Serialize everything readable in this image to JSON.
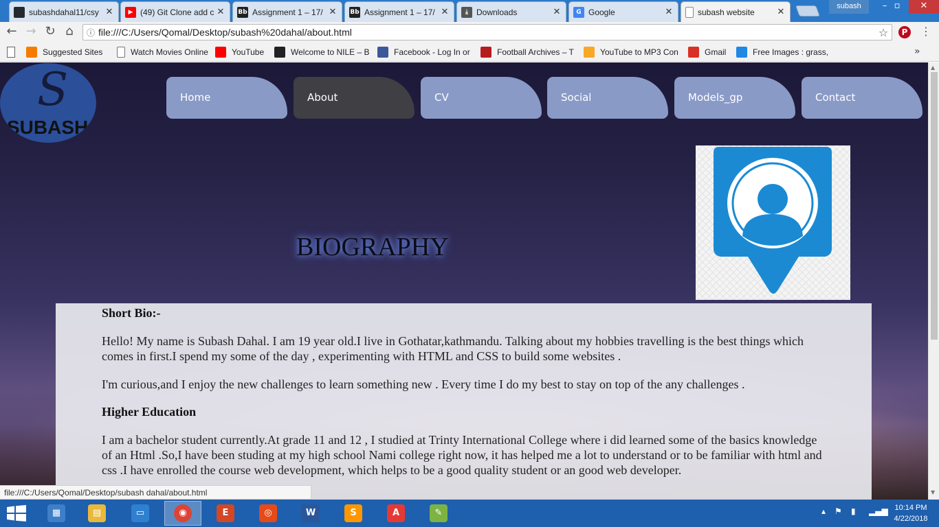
{
  "browser": {
    "tabs": [
      {
        "title": "subashdahal11/csy",
        "icon": "github-icon",
        "color": "#24292e",
        "glyph": ""
      },
      {
        "title": "(49) Git Clone add c",
        "icon": "youtube-icon",
        "color": "#ff0000",
        "glyph": "▶"
      },
      {
        "title": "Assignment 1 – 17/",
        "icon": "blackboard-icon",
        "color": "#222222",
        "glyph": "Bb"
      },
      {
        "title": "Assignment 1 – 17/",
        "icon": "blackboard-icon",
        "color": "#222222",
        "glyph": "Bb"
      },
      {
        "title": "Downloads",
        "icon": "download-icon",
        "color": "#555555",
        "glyph": "⤓"
      },
      {
        "title": "Google",
        "icon": "google-icon",
        "color": "#4285f4",
        "glyph": "G"
      },
      {
        "title": "subash website",
        "icon": "page-icon",
        "color": "#ffffff",
        "glyph": ""
      }
    ],
    "user": "subash",
    "url": "file:///C:/Users/Qomal/Desktop/subash%20dahal/about.html",
    "bookmarks": [
      {
        "label": "Suggested Sites",
        "icon": "suggested-sites-icon",
        "color": "#f57c00"
      },
      {
        "label": "Watch Movies Online",
        "icon": "page-icon",
        "color": "#ffffff"
      },
      {
        "label": "YouTube",
        "icon": "youtube-icon",
        "color": "#ff0000"
      },
      {
        "label": "Welcome to NILE – B",
        "icon": "blackboard-icon",
        "color": "#222222"
      },
      {
        "label": "Facebook - Log In or",
        "icon": "facebook-icon",
        "color": "#3b5998"
      },
      {
        "label": "Football Archives – T",
        "icon": "ts-icon",
        "color": "#b71c1c"
      },
      {
        "label": "YouTube to MP3 Con",
        "icon": "mp3-icon",
        "color": "#f9a825"
      },
      {
        "label": "Gmail",
        "icon": "gmail-icon",
        "color": "#d93025"
      },
      {
        "label": "Free Images : grass, l",
        "icon": "ph-icon",
        "color": "#1e88e5"
      }
    ],
    "status_url": "file:///C:/Users/Qomal/Desktop/subash dahal/about.html"
  },
  "site": {
    "logo_text": "SUBASH",
    "logo_glyph": "S",
    "nav": [
      "Home",
      "About",
      "CV",
      "Social",
      "Models_gp",
      "Contact"
    ],
    "active_nav": "About",
    "heading": "BIOGRAPHY",
    "sections": {
      "short_bio_title": "Short Bio:-",
      "short_bio_p1": "Hello! My name is Subash Dahal. I am 19 year old.I live in Gothatar,kathmandu. Talking about my hobbies travelling is the best things which comes in first.I spend my some of the day , experimenting with HTML and CSS to build some websites .",
      "short_bio_p2": "I'm curious,and I enjoy the new challenges to learn something new . Every time I do my best to stay on top of the any challenges .",
      "education_title": "Higher Education",
      "education_p1": "I am a bachelor student currently.At grade 11 and 12 , I studied at Trinty International College where i did learned some of the basics knowledge of an Html .So,I have been studing at my high school Nami college right now, it has helped me a lot to understand or to be familiar with html and css .I have enrolled the course web development, which helps to be a good quality student or an good web developer."
    },
    "colors": {
      "nav": "#8a9ac7",
      "nav_active": "#3f3f44",
      "profile_blue": "#1b8ad3"
    }
  },
  "taskbar": {
    "apps": [
      {
        "name": "control-panel-icon",
        "color": "#3f7fc7",
        "glyph": "▦"
      },
      {
        "name": "file-explorer-icon",
        "color": "#e9b93c",
        "glyph": "▤"
      },
      {
        "name": "remote-desktop-icon",
        "color": "#2f80d0",
        "glyph": "▭"
      },
      {
        "name": "chrome-icon",
        "color": "#db4437",
        "glyph": "◉"
      },
      {
        "name": "office-icon",
        "color": "#d24726",
        "glyph": "E"
      },
      {
        "name": "camera-app-icon",
        "color": "#e64a19",
        "glyph": "◎"
      },
      {
        "name": "word-icon",
        "color": "#2b579a",
        "glyph": "W"
      },
      {
        "name": "sublime-icon",
        "color": "#ff9800",
        "glyph": "S"
      },
      {
        "name": "acrobat-icon",
        "color": "#e53935",
        "glyph": "A"
      },
      {
        "name": "paint-icon",
        "color": "#7cb342",
        "glyph": "✎"
      }
    ],
    "time": "10:14 PM",
    "date": "4/22/2018"
  }
}
